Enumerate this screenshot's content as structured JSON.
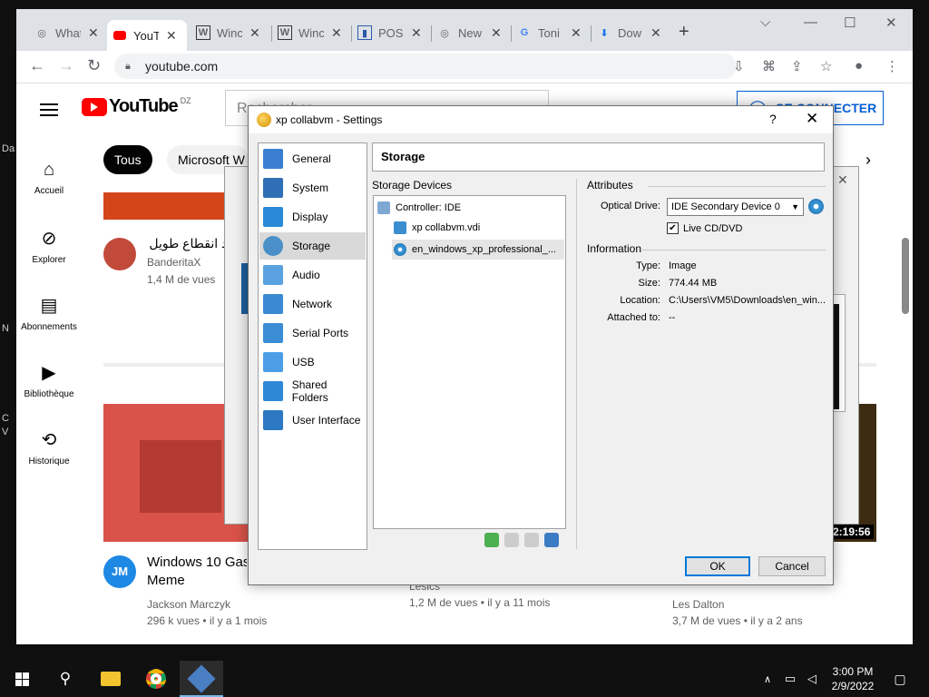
{
  "browser": {
    "tabs": [
      {
        "title": "What",
        "icon": "chrome-icon"
      },
      {
        "title": "YouT",
        "icon": "youtube-icon"
      },
      {
        "title": "Winc",
        "icon": "wikipedia-icon"
      },
      {
        "title": "Winc",
        "icon": "wikipedia-icon"
      },
      {
        "title": "POS",
        "icon": "page-icon"
      },
      {
        "title": "New",
        "icon": "chrome-icon"
      },
      {
        "title": "Toni",
        "icon": "google-icon"
      },
      {
        "title": "Dow",
        "icon": "download-icon"
      }
    ],
    "url": "youtube.com"
  },
  "youtube": {
    "logo": "YouTube",
    "region": "DZ",
    "search_placeholder": "Rechercher",
    "signin": "SE CONNECTER",
    "sidebar": [
      {
        "label": "Accueil",
        "icon": "home-icon"
      },
      {
        "label": "Explorer",
        "icon": "compass-icon"
      },
      {
        "label": "Abonnements",
        "icon": "subscriptions-icon"
      },
      {
        "label": "Bibliothèque",
        "icon": "library-icon"
      },
      {
        "label": "Historique",
        "icon": "history-icon"
      }
    ],
    "chips": [
      "Tous",
      "Microsoft W"
    ],
    "videos": [
      {
        "title": "بعد انقطاع طويل 2",
        "channel": "BanderitaX",
        "meta": "1,4 M de vues"
      },
      {
        "title": "Windows 10 Gas",
        "title2": "Meme",
        "channel": "Jackson Marczyk",
        "meta": "296 k vues • il y a 1 mois"
      },
      {
        "channel": "Lesics",
        "meta": "1,2 M de vues • il y a 11 mois"
      },
      {
        "channel": "Les Dalton",
        "meta": "3,7 M de vues • il y a 2 ans",
        "duration": "2:19:56"
      }
    ],
    "edge_text": {
      "da": "Da",
      "n": "N",
      "c": "C",
      "v": "V"
    }
  },
  "dialog": {
    "title": "xp collabvm - Settings",
    "help": "?",
    "close": "✕",
    "categories": [
      {
        "label": "General",
        "color": "#3a7fd0"
      },
      {
        "label": "System",
        "color": "#2f6fb5"
      },
      {
        "label": "Display",
        "color": "#2a8ad8"
      },
      {
        "label": "Storage",
        "color": "#4a8fc7"
      },
      {
        "label": "Audio",
        "color": "#5aa3e0"
      },
      {
        "label": "Network",
        "color": "#3a89d1"
      },
      {
        "label": "Serial Ports",
        "color": "#3b8dd4"
      },
      {
        "label": "USB",
        "color": "#4b9de6"
      },
      {
        "label": "Shared Folders",
        "color": "#2f88d6"
      },
      {
        "label": "User Interface",
        "color": "#2c78c2"
      }
    ],
    "selected_category": "Storage",
    "page_title": "Storage",
    "storage_devices_label": "Storage Devices",
    "tree": {
      "controller": "Controller: IDE",
      "disks": [
        "xp collabvm.vdi",
        "en_windows_xp_professional_..."
      ]
    },
    "attributes": {
      "title": "Attributes",
      "optical_drive_label": "Optical Drive:",
      "optical_drive_value": "IDE Secondary Device 0",
      "live_cd_label": "Live CD/DVD",
      "live_cd_checked": true
    },
    "information": {
      "title": "Information",
      "rows": [
        {
          "label": "Type:",
          "value": "Image"
        },
        {
          "label": "Size:",
          "value": "774.44 MB"
        },
        {
          "label": "Location:",
          "value": "C:\\Users\\VM5\\Downloads\\en_win..."
        },
        {
          "label": "Attached to:",
          "value": "--"
        }
      ]
    },
    "ok": "OK",
    "cancel": "Cancel"
  },
  "taskbar": {
    "time": "3:00 PM",
    "date": "2/9/2022"
  }
}
